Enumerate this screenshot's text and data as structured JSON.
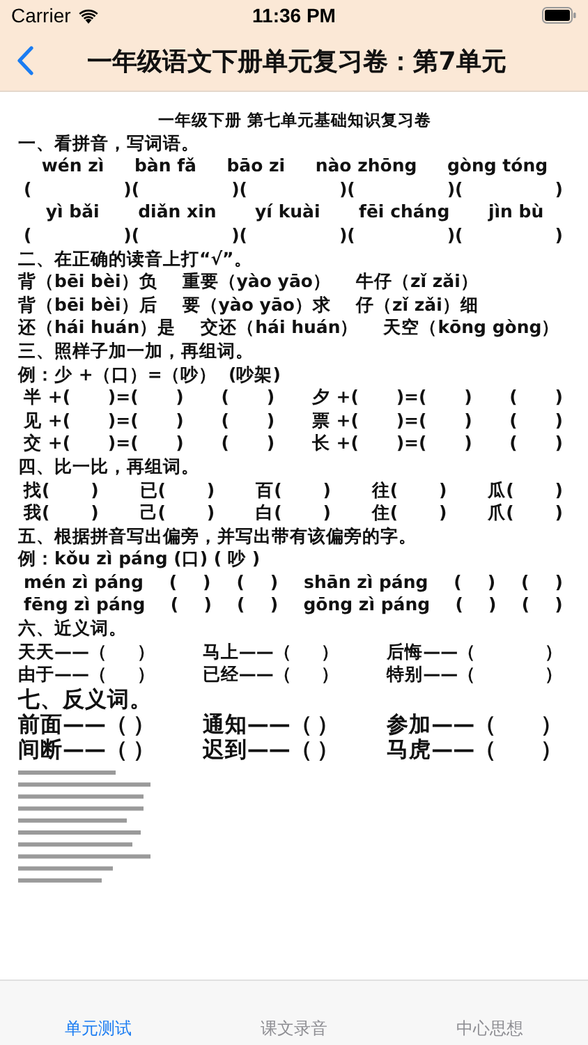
{
  "status_bar": {
    "carrier": "Carrier",
    "time": "11:36 PM"
  },
  "nav": {
    "title": "一年级语文下册单元复习卷：第7单元"
  },
  "document": {
    "lines": [
      {
        "kind": "title",
        "cells": [
          "一年级下册 第七单元基础知识复习卷"
        ]
      },
      {
        "kind": "heading",
        "cells": [
          "一、看拼音，写词语。"
        ]
      },
      {
        "kind": "pinyin",
        "cells": [
          "wén zì",
          "bàn fǎ",
          "bāo zi",
          "nào zhōng",
          "gòng tóng"
        ]
      },
      {
        "kind": "spread",
        "cells": [
          "(",
          ")(",
          ")(",
          ")(",
          ")(",
          ")"
        ]
      },
      {
        "kind": "pinyin",
        "cells": [
          "yì bǎi",
          "diǎn xin",
          "yí kuài",
          "fēi cháng",
          "jìn bù"
        ]
      },
      {
        "kind": "spread",
        "cells": [
          "(",
          ")(",
          ")(",
          ")(",
          ")(",
          ")"
        ]
      },
      {
        "kind": "heading",
        "cells": [
          "二、在正确的读音上打“√”。"
        ]
      },
      {
        "kind": "row",
        "cells": [
          "背（bēi bèi）负",
          "重要（yào yāo）",
          "牛仔（zǐ zǎi）"
        ]
      },
      {
        "kind": "row",
        "cells": [
          "背（bēi bèi）后",
          "要（yào yāo）求",
          "仔（zǐ zǎi）细"
        ]
      },
      {
        "kind": "row",
        "cells": [
          "还（hái huán）是",
          "交还（hái huán）",
          "天空（kōng gòng）"
        ]
      },
      {
        "kind": "heading",
        "cells": [
          "三、照样子加一加，再组词。"
        ]
      },
      {
        "kind": "text",
        "cells": [
          "例：少 +（口）=（吵）  (吵架)"
        ]
      },
      {
        "kind": "spread",
        "cells": [
          "半 +(",
          ")=(",
          ")",
          "(",
          ")",
          "夕 +(",
          ")=(",
          ")",
          "(",
          ")"
        ]
      },
      {
        "kind": "spread",
        "cells": [
          "见 +(",
          ")=(",
          ")",
          "(",
          ")",
          "票 +(",
          ")=(",
          ")",
          "(",
          ")"
        ]
      },
      {
        "kind": "spread",
        "cells": [
          "交 +(",
          ")=(",
          ")",
          "(",
          ")",
          "长 +(",
          ")=(",
          ")",
          "(",
          ")"
        ]
      },
      {
        "kind": "heading",
        "cells": [
          "四、比一比，再组词。"
        ]
      },
      {
        "kind": "spread",
        "cells": [
          "找(",
          ")",
          "已(",
          ")",
          "百(",
          ")",
          "往(",
          ")",
          "瓜(",
          ")"
        ]
      },
      {
        "kind": "spread",
        "cells": [
          "我(",
          ")",
          "己(",
          ")",
          "白(",
          ")",
          "住(",
          ")",
          "爪(",
          ")"
        ]
      },
      {
        "kind": "heading",
        "cells": [
          "五、根据拼音写出偏旁，并写出带有该偏旁的字。"
        ]
      },
      {
        "kind": "text",
        "cells": [
          "例：kǒu zì páng (口) ( 吵 )"
        ]
      },
      {
        "kind": "spread",
        "cells": [
          "mén zì páng",
          "(",
          ")",
          "(",
          ")",
          "shān zì páng",
          "(",
          ")",
          "(",
          ")"
        ]
      },
      {
        "kind": "spread",
        "cells": [
          "fēng zì páng",
          "(",
          ")",
          "(",
          ")",
          "gōng zì páng",
          "(",
          ")",
          "(",
          ")"
        ]
      },
      {
        "kind": "heading",
        "cells": [
          "六、近义词。"
        ]
      },
      {
        "kind": "pairs",
        "cells": [
          "天天——（",
          "）",
          "马上——（",
          "）",
          "后悔——（",
          "）"
        ]
      },
      {
        "kind": "pairs",
        "cells": [
          "由于——（",
          "）",
          "已经——（",
          "）",
          "特别——（",
          "）"
        ]
      },
      {
        "kind": "big_heading",
        "cells": [
          "七、反义词。"
        ]
      },
      {
        "kind": "big_pairs",
        "cells": [
          "前面——（",
          "）",
          "通知——（",
          "）",
          "参加——（",
          "）"
        ]
      },
      {
        "kind": "big_pairs",
        "cells": [
          "间断——（",
          "）",
          "迟到——（",
          "）",
          "马虎——（",
          "）"
        ]
      }
    ]
  },
  "tabs": [
    {
      "label": "单元测试",
      "selected": true
    },
    {
      "label": "课文录音",
      "selected": false
    },
    {
      "label": "中心思想",
      "selected": false
    }
  ]
}
